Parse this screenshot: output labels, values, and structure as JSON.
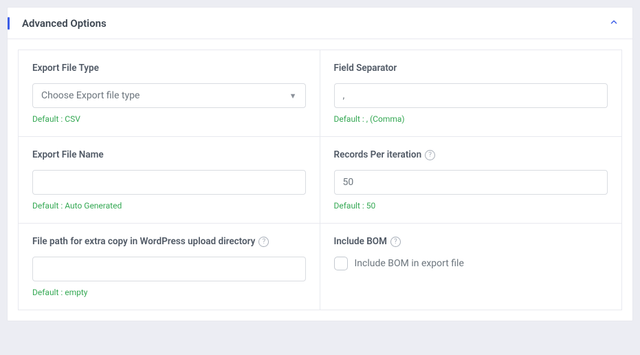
{
  "panel": {
    "title": "Advanced Options"
  },
  "fields": {
    "export_file_type": {
      "label": "Export File Type",
      "placeholder": "Choose Export file type",
      "default": "Default : CSV"
    },
    "field_separator": {
      "label": "Field Separator",
      "value": ",",
      "default": "Default : , (Comma)"
    },
    "export_file_name": {
      "label": "Export File Name",
      "value": "",
      "default": "Default : Auto Generated"
    },
    "records_per_iteration": {
      "label": "Records Per iteration",
      "value": "50",
      "default": "Default : 50"
    },
    "file_path": {
      "label": "File path for extra copy in WordPress upload directory",
      "value": "",
      "default": "Default : empty"
    },
    "include_bom": {
      "label": "Include BOM",
      "checkbox_label": "Include BOM in export file"
    }
  }
}
